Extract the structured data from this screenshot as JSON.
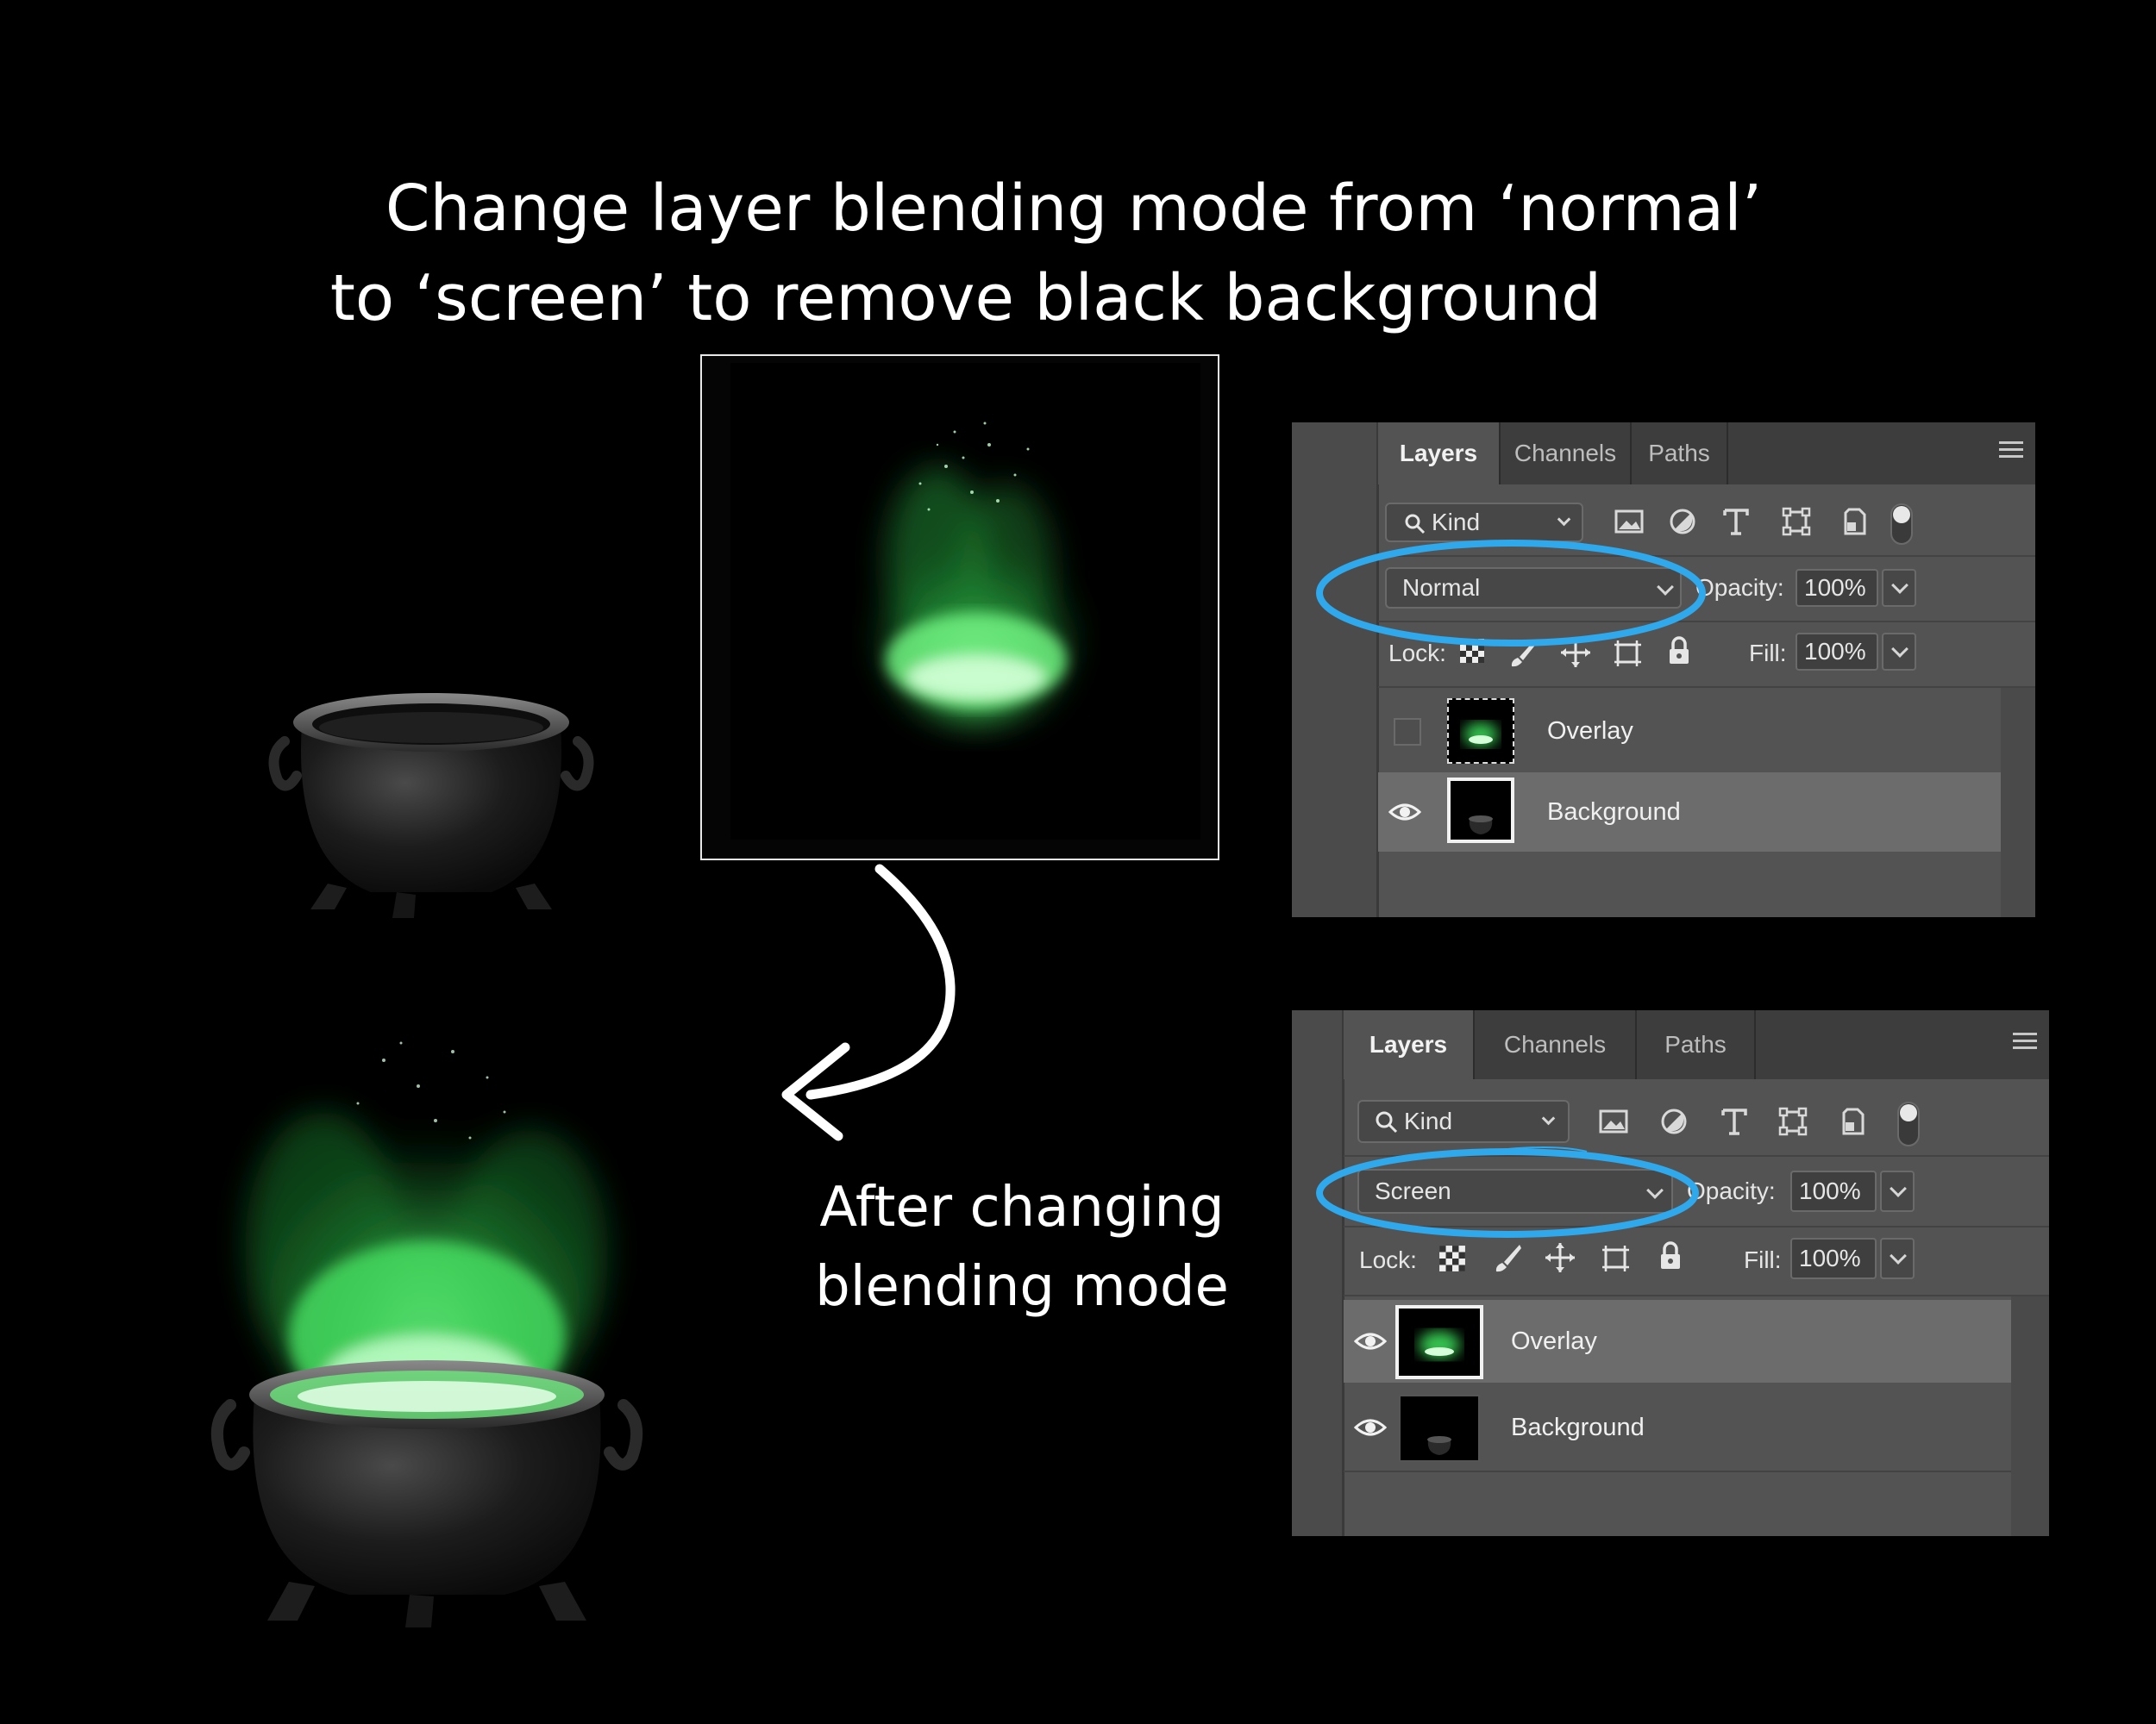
{
  "headline": {
    "line1": "Change layer blending mode from ‘normal’",
    "line2": "to ‘screen’ to remove black background"
  },
  "caption": {
    "line1": "After changing",
    "line2": "blending mode"
  },
  "colors": {
    "highlight_ring": "#2fa8ec",
    "smoke_green": "#3ddc5a",
    "panel_bg": "#535353"
  },
  "panel_before": {
    "tabs": [
      "Layers",
      "Channels",
      "Paths"
    ],
    "kind_label": "Kind",
    "blend_mode": "Normal",
    "opacity_label": "Opacity:",
    "opacity_value": "100%",
    "lock_label": "Lock:",
    "fill_label": "Fill:",
    "fill_value": "100%",
    "layers": [
      {
        "name": "Overlay",
        "visible": false,
        "selected": false
      },
      {
        "name": "Background",
        "visible": true,
        "selected": true
      }
    ]
  },
  "panel_after": {
    "tabs": [
      "Layers",
      "Channels",
      "Paths"
    ],
    "kind_label": "Kind",
    "blend_mode": "Screen",
    "opacity_label": "Opacity:",
    "opacity_value": "100%",
    "lock_label": "Lock:",
    "fill_label": "Fill:",
    "fill_value": "100%",
    "layers": [
      {
        "name": "Overlay",
        "visible": true,
        "selected": true
      },
      {
        "name": "Background",
        "visible": true,
        "selected": false
      }
    ]
  }
}
